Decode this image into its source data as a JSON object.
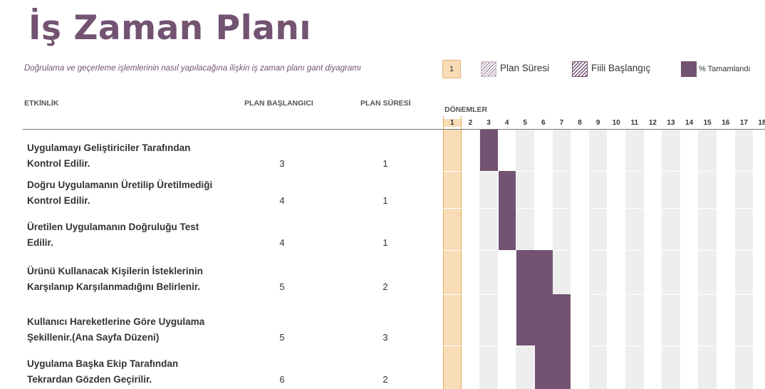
{
  "header": {
    "title": "İş Zaman Planı",
    "subtitle": "Doğrulama ve geçerleme işlemlerinin nasıl yapılacağına ilişkin iş zaman planı gant diyagramı"
  },
  "legend": {
    "highlight_value": "1",
    "plan_duration": "Plan Süresi",
    "actual_start": "Fiili Başlangıç",
    "percent_complete": "% Tamamlandı"
  },
  "columns": {
    "activity": "ETKİNLİK",
    "plan_start": "PLAN BAŞLANGICI",
    "plan_duration": "PLAN SÜRESİ",
    "periods": "DÖNEMLER"
  },
  "periods": [
    "1",
    "2",
    "3",
    "4",
    "5",
    "6",
    "7",
    "8",
    "9",
    "10",
    "11",
    "12",
    "13",
    "14",
    "15",
    "16",
    "17",
    "18"
  ],
  "highlight_period": 1,
  "tasks": [
    {
      "line1": "Uygulamayı Geliştiriciler Tarafından",
      "line2": "Kontrol Edilir.",
      "start": "3",
      "duration": "1"
    },
    {
      "line1": "Doğru Uygulamanın Üretilip Üretilmediği",
      "line2": "Kontrol Edilir.",
      "start": "4",
      "duration": "1"
    },
    {
      "line1": "Üretilen Uygulamanın Doğruluğu Test",
      "line2": "Edilir.",
      "start": "4",
      "duration": "1"
    },
    {
      "line1": "Ürünü Kullanacak Kişilerin İsteklerinin",
      "line2": "Karşılanıp Karşılanmadığını Belirlenir.",
      "start": "5",
      "duration": "2"
    },
    {
      "line1": "Kullanıcı Hareketlerine Göre Uygulama",
      "line2": "Şekillenir.(Ana Sayfa Düzeni)",
      "start": "5",
      "duration": "3"
    },
    {
      "line1": "Uygulama Başka Ekip Tarafından",
      "line2": "Tekrardan Gözden Geçirilir.",
      "start": "6",
      "duration": "2"
    }
  ],
  "colors": {
    "accent": "#735372",
    "highlight": "#f8dcb6"
  }
}
